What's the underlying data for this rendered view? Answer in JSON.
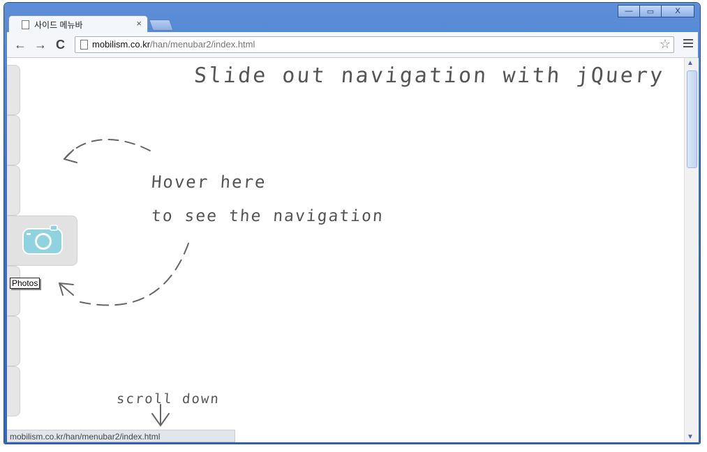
{
  "window": {
    "controls": {
      "minimize": "—",
      "maximize": "▭",
      "close": "X"
    }
  },
  "tab": {
    "title": "사이드 메뉴바",
    "close": "×"
  },
  "toolbar": {
    "back": "←",
    "forward": "→",
    "reload": "C",
    "url_host": "mobilism.co.kr",
    "url_path": "/han/menubar2/index.html",
    "bookmark_icon": "star-icon"
  },
  "page": {
    "heading": "Slide out navigation with jQuery",
    "hover_line1": "Hover here",
    "hover_line2": "to see the navigation",
    "scroll_hint": "scroll down",
    "sidebar_tooltip": "Photos",
    "sidebar_active_icon": "camera-icon",
    "sidebar_tab_count": 7
  },
  "status_bar": {
    "text": "mobilism.co.kr/han/menubar2/index.html"
  },
  "colors": {
    "frame": "#3d72c8",
    "sidebar": "#e6e6e6",
    "camera": "#8fd3e0"
  }
}
